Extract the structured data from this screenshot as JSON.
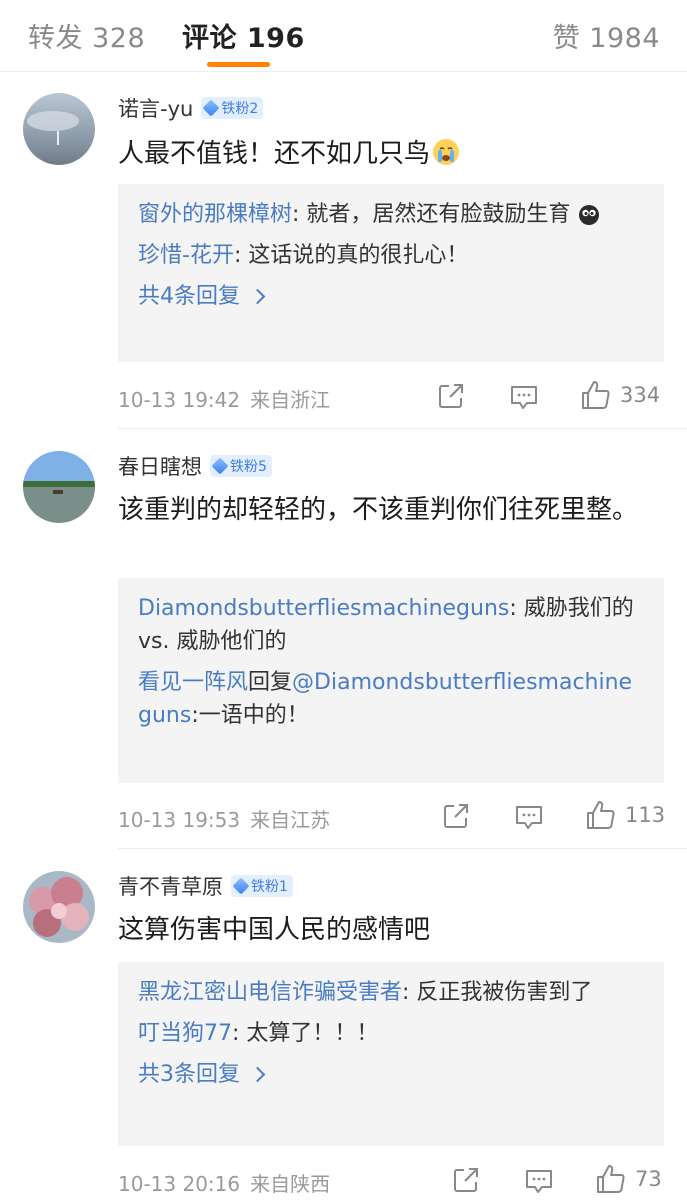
{
  "tabs": {
    "repost": "转发 328",
    "comments": "评论 196",
    "likes": "赞 1984",
    "accent_color": "#ff8200"
  },
  "comments": [
    {
      "username": "诺言-yu",
      "badge": "铁粉2",
      "content": "人最不值钱！还不如几只鸟",
      "content_emoji": "crying-face-icon",
      "replies": [
        {
          "name": "窗外的那棵樟树",
          "text": ": 就者，居然还有脸鼓励生育",
          "emoji": "face-emoji-icon"
        },
        {
          "name": "珍惜-花开",
          "text": ": 这话说的真的很扎心！"
        }
      ],
      "more_replies": "共4条回复",
      "time": "10-13 19:42",
      "location": "来自浙江",
      "likes": "334"
    },
    {
      "username": "春日瞎想",
      "badge": "铁粉5",
      "content": "该重判的却轻轻的，不该重判你们往死里整。",
      "replies": [
        {
          "name": "Diamondsbutterfliesmachineguns",
          "text": ": 威胁我们的 vs. 威胁他们的"
        },
        {
          "name": "看见一阵风",
          "middle": "回复",
          "name2": "@Diamondsbutterfliesmachineguns",
          "text": ":一语中的！"
        }
      ],
      "time": "10-13 19:53",
      "location": "来自江苏",
      "likes": "113"
    },
    {
      "username": "青不青草原",
      "badge": "铁粉1",
      "content": "这算伤害中国人民的感情吧",
      "replies": [
        {
          "name": "黑龙江密山电信诈骗受害者",
          "text": ": 反正我被伤害到了"
        },
        {
          "name": "叮当狗77",
          "text": ": 太算了！！！"
        }
      ],
      "more_replies": "共3条回复",
      "time": "10-13 20:16",
      "location": "来自陕西",
      "likes": "73"
    }
  ]
}
